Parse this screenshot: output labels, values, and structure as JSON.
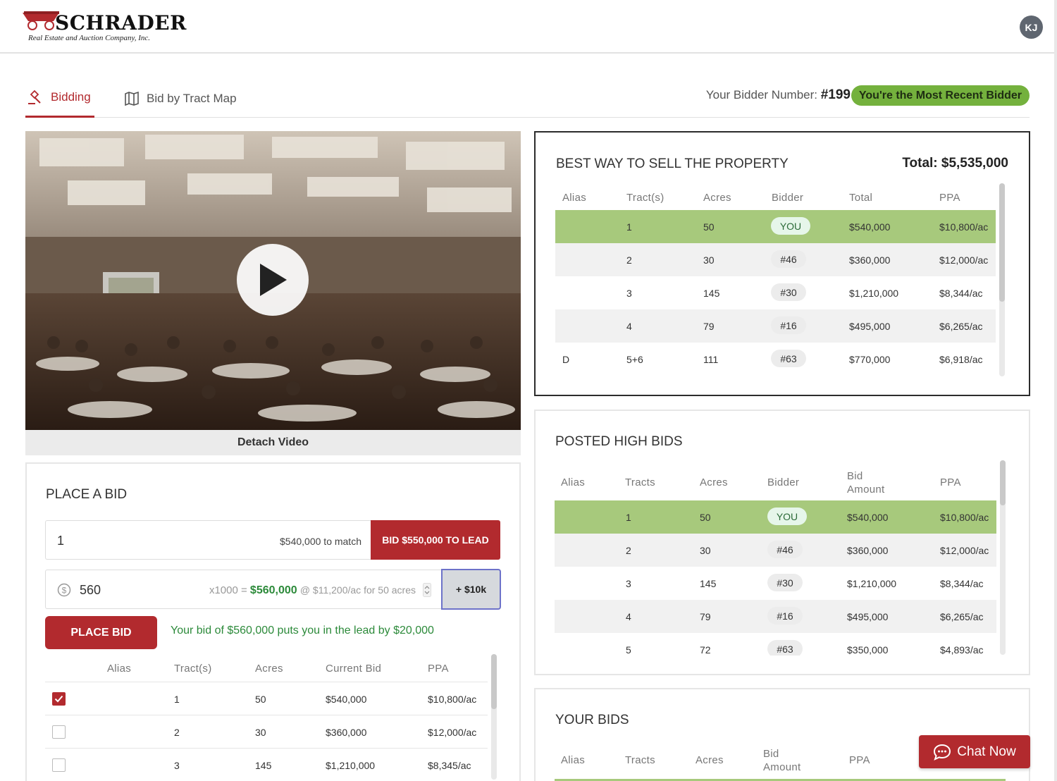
{
  "brand": {
    "name": "SCHRADER",
    "tagline": "Real Estate and Auction Company, Inc.",
    "accent": "#b22a2e"
  },
  "user": {
    "initials": "KJ"
  },
  "tabs": [
    {
      "label": "Bidding",
      "icon": "gavel-icon",
      "active": true
    },
    {
      "label": "Bid by Tract Map",
      "icon": "map-icon",
      "active": false
    }
  ],
  "bidder": {
    "label": "Your Bidder Number:",
    "number": "#199",
    "status": "You're the Most Recent Bidder"
  },
  "video": {
    "detach_label": "Detach Video"
  },
  "best_way": {
    "title": "BEST WAY TO SELL THE PROPERTY",
    "total": "Total: $5,535,000",
    "columns": [
      "Alias",
      "Tract(s)",
      "Acres",
      "Bidder",
      "Total",
      "PPA"
    ],
    "rows": [
      {
        "alias": "",
        "tracts": "1",
        "acres": "50",
        "bidder": "YOU",
        "total": "$540,000",
        "ppa": "$10,800/ac"
      },
      {
        "alias": "",
        "tracts": "2",
        "acres": "30",
        "bidder": "#46",
        "total": "$360,000",
        "ppa": "$12,000/ac"
      },
      {
        "alias": "",
        "tracts": "3",
        "acres": "145",
        "bidder": "#30",
        "total": "$1,210,000",
        "ppa": "$8,344/ac"
      },
      {
        "alias": "",
        "tracts": "4",
        "acres": "79",
        "bidder": "#16",
        "total": "$495,000",
        "ppa": "$6,265/ac"
      },
      {
        "alias": "D",
        "tracts": "5+6",
        "acres": "111",
        "bidder": "#63",
        "total": "$770,000",
        "ppa": "$6,918/ac"
      }
    ]
  },
  "posted_high_bids": {
    "title": "POSTED HIGH BIDS",
    "columns": [
      "Alias",
      "Tracts",
      "Acres",
      "Bidder",
      "Bid Amount",
      "PPA"
    ],
    "rows": [
      {
        "alias": "",
        "tracts": "1",
        "acres": "50",
        "bidder": "YOU",
        "amount": "$540,000",
        "ppa": "$10,800/ac"
      },
      {
        "alias": "",
        "tracts": "2",
        "acres": "30",
        "bidder": "#46",
        "amount": "$360,000",
        "ppa": "$12,000/ac"
      },
      {
        "alias": "",
        "tracts": "3",
        "acres": "145",
        "bidder": "#30",
        "amount": "$1,210,000",
        "ppa": "$8,344/ac"
      },
      {
        "alias": "",
        "tracts": "4",
        "acres": "79",
        "bidder": "#16",
        "amount": "$495,000",
        "ppa": "$6,265/ac"
      },
      {
        "alias": "",
        "tracts": "5",
        "acres": "72",
        "bidder": "#63",
        "amount": "$350,000",
        "ppa": "$4,893/ac"
      }
    ]
  },
  "your_bids": {
    "title": "YOUR BIDS",
    "columns": [
      "Alias",
      "Tracts",
      "Acres",
      "Bid Amount",
      "PPA"
    ]
  },
  "place_bid": {
    "title": "PLACE A BID",
    "tract_value": "1",
    "match_text": "$540,000 to match",
    "lead_button": "BID $550,000 TO LEAD",
    "amount_value": "560",
    "multiplier": "x1000 =",
    "computed": "$560,000",
    "computed_detail": "@ $11,200/ac for 50 acres",
    "increment_button": "+ $10k",
    "place_button": "PLACE BID",
    "lead_message": "Your bid of $560,000 puts you in the lead by $20,000",
    "columns": [
      "Alias",
      "Tract(s)",
      "Acres",
      "Current Bid",
      "PPA"
    ],
    "rows": [
      {
        "checked": true,
        "alias": "",
        "tracts": "1",
        "acres": "50",
        "current": "$540,000",
        "ppa": "$10,800/ac"
      },
      {
        "checked": false,
        "alias": "",
        "tracts": "2",
        "acres": "30",
        "current": "$360,000",
        "ppa": "$12,000/ac"
      },
      {
        "checked": false,
        "alias": "",
        "tracts": "3",
        "acres": "145",
        "current": "$1,210,000",
        "ppa": "$8,345/ac"
      }
    ]
  },
  "chat": {
    "label": "Chat Now"
  }
}
